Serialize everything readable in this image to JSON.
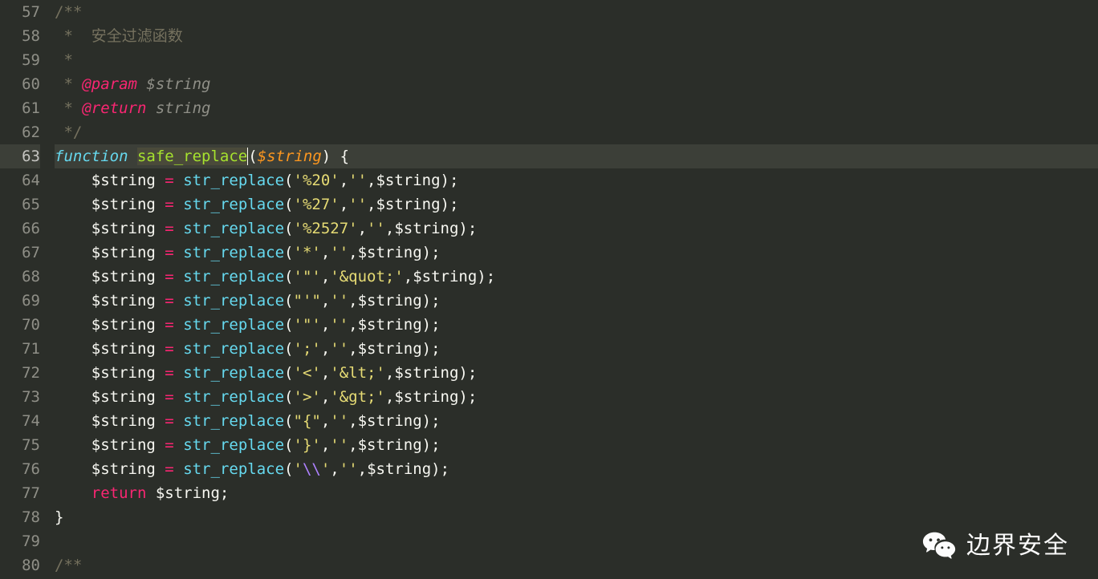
{
  "editor": {
    "startLine": 57,
    "activeLine": 63,
    "lines": [
      {
        "n": 57,
        "segments": [
          {
            "t": "c-comment",
            "text": "/**"
          }
        ]
      },
      {
        "n": 58,
        "segments": [
          {
            "t": "c-comment",
            "text": " *  "
          },
          {
            "t": "comment",
            "text": "安全过滤函数"
          }
        ]
      },
      {
        "n": 59,
        "segments": [
          {
            "t": "c-comment",
            "text": " *"
          }
        ]
      },
      {
        "n": 60,
        "segments": [
          {
            "t": "c-comment",
            "text": " * "
          },
          {
            "t": "doc-tag",
            "text": "@param"
          },
          {
            "t": "c-comment",
            "text": " "
          },
          {
            "t": "doc-type",
            "text": "$string"
          }
        ]
      },
      {
        "n": 61,
        "segments": [
          {
            "t": "c-comment",
            "text": " * "
          },
          {
            "t": "doc-tag",
            "text": "@return"
          },
          {
            "t": "c-comment",
            "text": " "
          },
          {
            "t": "doc-type",
            "text": "string"
          }
        ]
      },
      {
        "n": 62,
        "segments": [
          {
            "t": "c-comment",
            "text": " */"
          }
        ]
      },
      {
        "n": 63,
        "segments": [
          {
            "t": "keyword",
            "text": "function"
          },
          {
            "t": "punct",
            "text": " "
          },
          {
            "t": "func-name highlight cursor",
            "text": "safe_replace"
          },
          {
            "t": "punct",
            "text": "("
          },
          {
            "t": "var",
            "text": "$string"
          },
          {
            "t": "punct",
            "text": ") {"
          }
        ]
      },
      {
        "n": 64,
        "segments": [
          {
            "t": "punct",
            "text": "    "
          },
          {
            "t": "var-norm",
            "text": "$string"
          },
          {
            "t": "punct",
            "text": " "
          },
          {
            "t": "operator",
            "text": "="
          },
          {
            "t": "punct",
            "text": " "
          },
          {
            "t": "func-call",
            "text": "str_replace"
          },
          {
            "t": "punct",
            "text": "("
          },
          {
            "t": "string",
            "text": "'%20'"
          },
          {
            "t": "punct",
            "text": ","
          },
          {
            "t": "string",
            "text": "''"
          },
          {
            "t": "punct",
            "text": ",$string);"
          }
        ]
      },
      {
        "n": 65,
        "segments": [
          {
            "t": "punct",
            "text": "    "
          },
          {
            "t": "var-norm",
            "text": "$string"
          },
          {
            "t": "punct",
            "text": " "
          },
          {
            "t": "operator",
            "text": "="
          },
          {
            "t": "punct",
            "text": " "
          },
          {
            "t": "func-call",
            "text": "str_replace"
          },
          {
            "t": "punct",
            "text": "("
          },
          {
            "t": "string",
            "text": "'%27'"
          },
          {
            "t": "punct",
            "text": ","
          },
          {
            "t": "string",
            "text": "''"
          },
          {
            "t": "punct",
            "text": ",$string);"
          }
        ]
      },
      {
        "n": 66,
        "segments": [
          {
            "t": "punct",
            "text": "    "
          },
          {
            "t": "var-norm",
            "text": "$string"
          },
          {
            "t": "punct",
            "text": " "
          },
          {
            "t": "operator",
            "text": "="
          },
          {
            "t": "punct",
            "text": " "
          },
          {
            "t": "func-call",
            "text": "str_replace"
          },
          {
            "t": "punct",
            "text": "("
          },
          {
            "t": "string",
            "text": "'%2527'"
          },
          {
            "t": "punct",
            "text": ","
          },
          {
            "t": "string",
            "text": "''"
          },
          {
            "t": "punct",
            "text": ",$string);"
          }
        ]
      },
      {
        "n": 67,
        "segments": [
          {
            "t": "punct",
            "text": "    "
          },
          {
            "t": "var-norm",
            "text": "$string"
          },
          {
            "t": "punct",
            "text": " "
          },
          {
            "t": "operator",
            "text": "="
          },
          {
            "t": "punct",
            "text": " "
          },
          {
            "t": "func-call",
            "text": "str_replace"
          },
          {
            "t": "punct",
            "text": "("
          },
          {
            "t": "string",
            "text": "'*'"
          },
          {
            "t": "punct",
            "text": ","
          },
          {
            "t": "string",
            "text": "''"
          },
          {
            "t": "punct",
            "text": ",$string);"
          }
        ]
      },
      {
        "n": 68,
        "segments": [
          {
            "t": "punct",
            "text": "    "
          },
          {
            "t": "var-norm",
            "text": "$string"
          },
          {
            "t": "punct",
            "text": " "
          },
          {
            "t": "operator",
            "text": "="
          },
          {
            "t": "punct",
            "text": " "
          },
          {
            "t": "func-call",
            "text": "str_replace"
          },
          {
            "t": "punct",
            "text": "("
          },
          {
            "t": "string",
            "text": "'\"'"
          },
          {
            "t": "punct",
            "text": ","
          },
          {
            "t": "string",
            "text": "'&quot;'"
          },
          {
            "t": "punct",
            "text": ",$string);"
          }
        ]
      },
      {
        "n": 69,
        "segments": [
          {
            "t": "punct",
            "text": "    "
          },
          {
            "t": "var-norm",
            "text": "$string"
          },
          {
            "t": "punct",
            "text": " "
          },
          {
            "t": "operator",
            "text": "="
          },
          {
            "t": "punct",
            "text": " "
          },
          {
            "t": "func-call",
            "text": "str_replace"
          },
          {
            "t": "punct",
            "text": "("
          },
          {
            "t": "string",
            "text": "\"'\""
          },
          {
            "t": "punct",
            "text": ","
          },
          {
            "t": "string",
            "text": "''"
          },
          {
            "t": "punct",
            "text": ",$string);"
          }
        ]
      },
      {
        "n": 70,
        "segments": [
          {
            "t": "punct",
            "text": "    "
          },
          {
            "t": "var-norm",
            "text": "$string"
          },
          {
            "t": "punct",
            "text": " "
          },
          {
            "t": "operator",
            "text": "="
          },
          {
            "t": "punct",
            "text": " "
          },
          {
            "t": "func-call",
            "text": "str_replace"
          },
          {
            "t": "punct",
            "text": "("
          },
          {
            "t": "string",
            "text": "'\"'"
          },
          {
            "t": "punct",
            "text": ","
          },
          {
            "t": "string",
            "text": "''"
          },
          {
            "t": "punct",
            "text": ",$string);"
          }
        ]
      },
      {
        "n": 71,
        "segments": [
          {
            "t": "punct",
            "text": "    "
          },
          {
            "t": "var-norm",
            "text": "$string"
          },
          {
            "t": "punct",
            "text": " "
          },
          {
            "t": "operator",
            "text": "="
          },
          {
            "t": "punct",
            "text": " "
          },
          {
            "t": "func-call",
            "text": "str_replace"
          },
          {
            "t": "punct",
            "text": "("
          },
          {
            "t": "string",
            "text": "';'"
          },
          {
            "t": "punct",
            "text": ","
          },
          {
            "t": "string",
            "text": "''"
          },
          {
            "t": "punct",
            "text": ",$string);"
          }
        ]
      },
      {
        "n": 72,
        "segments": [
          {
            "t": "punct",
            "text": "    "
          },
          {
            "t": "var-norm",
            "text": "$string"
          },
          {
            "t": "punct",
            "text": " "
          },
          {
            "t": "operator",
            "text": "="
          },
          {
            "t": "punct",
            "text": " "
          },
          {
            "t": "func-call",
            "text": "str_replace"
          },
          {
            "t": "punct",
            "text": "("
          },
          {
            "t": "string",
            "text": "'<'"
          },
          {
            "t": "punct",
            "text": ","
          },
          {
            "t": "string",
            "text": "'&lt;'"
          },
          {
            "t": "punct",
            "text": ",$string);"
          }
        ]
      },
      {
        "n": 73,
        "segments": [
          {
            "t": "punct",
            "text": "    "
          },
          {
            "t": "var-norm",
            "text": "$string"
          },
          {
            "t": "punct",
            "text": " "
          },
          {
            "t": "operator",
            "text": "="
          },
          {
            "t": "punct",
            "text": " "
          },
          {
            "t": "func-call",
            "text": "str_replace"
          },
          {
            "t": "punct",
            "text": "("
          },
          {
            "t": "string",
            "text": "'>'"
          },
          {
            "t": "punct",
            "text": ","
          },
          {
            "t": "string",
            "text": "'&gt;'"
          },
          {
            "t": "punct",
            "text": ",$string);"
          }
        ]
      },
      {
        "n": 74,
        "segments": [
          {
            "t": "punct",
            "text": "    "
          },
          {
            "t": "var-norm",
            "text": "$string"
          },
          {
            "t": "punct",
            "text": " "
          },
          {
            "t": "operator",
            "text": "="
          },
          {
            "t": "punct",
            "text": " "
          },
          {
            "t": "func-call",
            "text": "str_replace"
          },
          {
            "t": "punct",
            "text": "("
          },
          {
            "t": "string",
            "text": "\"{\""
          },
          {
            "t": "punct",
            "text": ","
          },
          {
            "t": "string",
            "text": "''"
          },
          {
            "t": "punct",
            "text": ",$string);"
          }
        ]
      },
      {
        "n": 75,
        "segments": [
          {
            "t": "punct",
            "text": "    "
          },
          {
            "t": "var-norm",
            "text": "$string"
          },
          {
            "t": "punct",
            "text": " "
          },
          {
            "t": "operator",
            "text": "="
          },
          {
            "t": "punct",
            "text": " "
          },
          {
            "t": "func-call",
            "text": "str_replace"
          },
          {
            "t": "punct",
            "text": "("
          },
          {
            "t": "string",
            "text": "'}'"
          },
          {
            "t": "punct",
            "text": ","
          },
          {
            "t": "string",
            "text": "''"
          },
          {
            "t": "punct",
            "text": ",$string);"
          }
        ]
      },
      {
        "n": 76,
        "segments": [
          {
            "t": "punct",
            "text": "    "
          },
          {
            "t": "var-norm",
            "text": "$string"
          },
          {
            "t": "punct",
            "text": " "
          },
          {
            "t": "operator",
            "text": "="
          },
          {
            "t": "punct",
            "text": " "
          },
          {
            "t": "func-call",
            "text": "str_replace"
          },
          {
            "t": "punct",
            "text": "("
          },
          {
            "t": "string",
            "text": "'"
          },
          {
            "t": "escape",
            "text": "\\\\"
          },
          {
            "t": "string",
            "text": "'"
          },
          {
            "t": "punct",
            "text": ","
          },
          {
            "t": "string",
            "text": "''"
          },
          {
            "t": "punct",
            "text": ",$string);"
          }
        ]
      },
      {
        "n": 77,
        "segments": [
          {
            "t": "punct",
            "text": "    "
          },
          {
            "t": "return-kw",
            "text": "return"
          },
          {
            "t": "punct",
            "text": " $string;"
          }
        ]
      },
      {
        "n": 78,
        "segments": [
          {
            "t": "punct",
            "text": "}"
          }
        ]
      },
      {
        "n": 79,
        "segments": [
          {
            "t": "punct",
            "text": ""
          }
        ]
      },
      {
        "n": 80,
        "segments": [
          {
            "t": "c-comment",
            "text": "/**"
          }
        ]
      }
    ]
  },
  "watermark": {
    "text": "边界安全"
  }
}
